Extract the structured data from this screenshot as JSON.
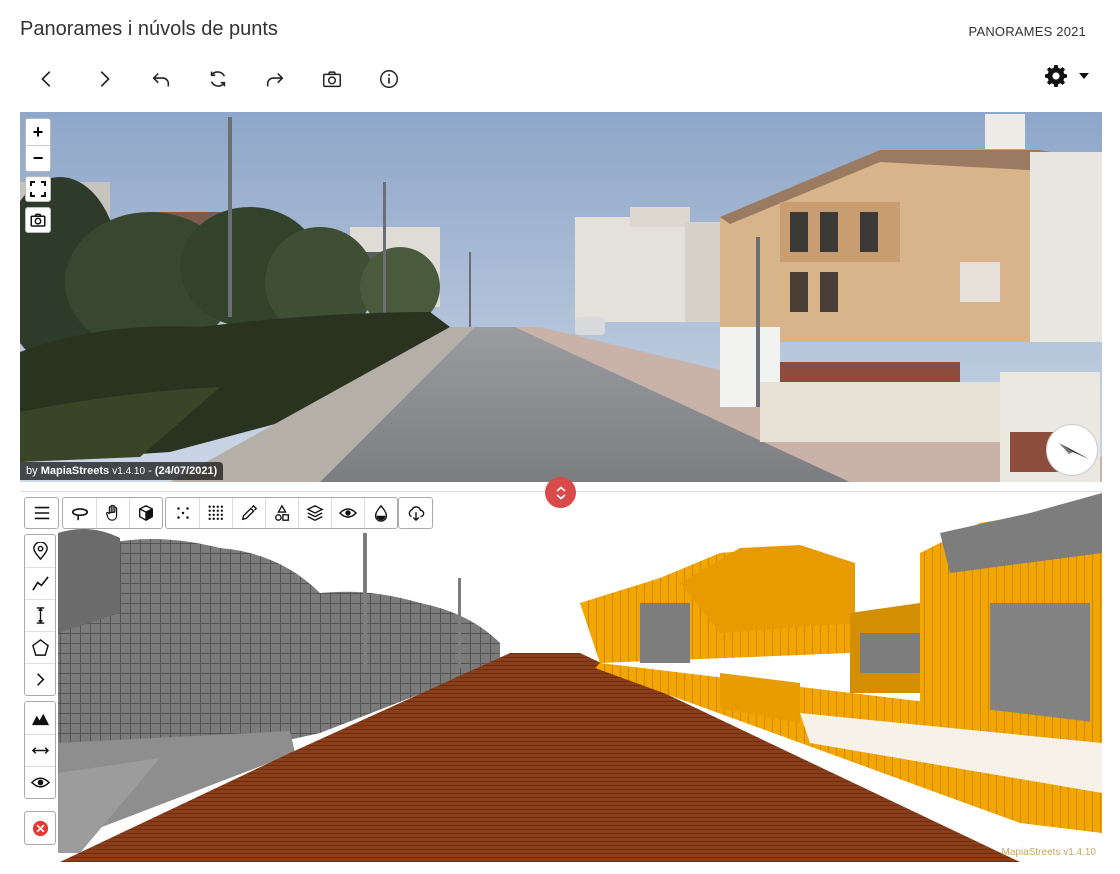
{
  "header": {
    "title": "Panorames i núvols de punts",
    "collection": "PANORAMES 2021"
  },
  "toolbar": {
    "buttons": [
      {
        "name": "back",
        "icon": "chevron-left-icon"
      },
      {
        "name": "forward",
        "icon": "chevron-right-icon"
      },
      {
        "name": "undo",
        "icon": "undo-icon"
      },
      {
        "name": "refresh",
        "icon": "refresh-icon"
      },
      {
        "name": "redo",
        "icon": "redo-icon"
      },
      {
        "name": "snapshot",
        "icon": "camera-icon"
      },
      {
        "name": "info",
        "icon": "info-icon"
      }
    ],
    "settings_icon": "gear-icon",
    "settings_dropdown_icon": "caret-down-icon"
  },
  "panorama": {
    "credit_prefix": "by",
    "credit_brand": "MapiaStreets",
    "credit_version": "v1.4.10",
    "credit_sep": "-",
    "credit_date": "(24/07/2021)",
    "zoom_in": "+",
    "zoom_out": "−",
    "controls": [
      "fullscreen-icon",
      "camera-icon"
    ],
    "compass_icon": "compass-icon"
  },
  "divider": {
    "icon": "expand-vertical-icon",
    "color": "#d94a4a"
  },
  "pointcloud": {
    "top_tools": [
      [
        "menu-icon"
      ],
      [
        "orbit-icon",
        "pan-hand-icon",
        "cube-icon"
      ],
      [
        "sparse-points-icon",
        "dense-points-icon",
        "eyedropper-icon",
        "shapes-icon",
        "layers-icon",
        "eye-icon",
        "drop-icon"
      ],
      [
        "cloud-download-icon"
      ]
    ],
    "side_tools": [
      [
        "location-pin-icon",
        "polyline-icon",
        "height-measure-icon",
        "polygon-icon",
        "chevron-right-icon"
      ],
      [
        "terrain-profile-icon",
        "horizontal-measure-icon",
        "eye-icon"
      ],
      [
        "close-red-icon"
      ]
    ],
    "watermark": "MapiaStreets v1.4.10",
    "colors": {
      "ground": "#8a3d18",
      "building": "#f3a500",
      "vegetation": "#7b7b7b"
    }
  },
  "colors": {
    "accent": "#d94a4a",
    "sky": "#a9bdd8"
  }
}
